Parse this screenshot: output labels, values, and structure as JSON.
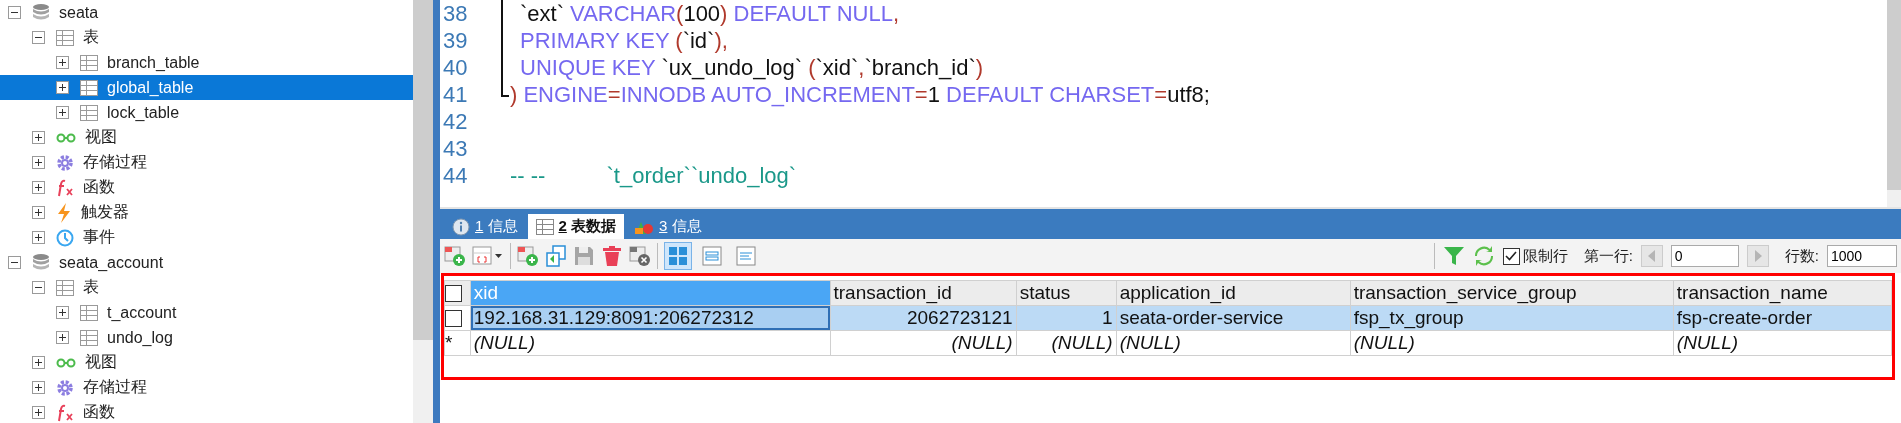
{
  "sidebar": {
    "items": [
      {
        "label": "seata",
        "kind": "database",
        "expanded": true,
        "selected": false,
        "children": [
          {
            "label": "表",
            "kind": "tables",
            "expanded": true,
            "selected": false,
            "children": [
              {
                "label": "branch_table",
                "kind": "table",
                "expanded": false,
                "selected": false
              },
              {
                "label": "global_table",
                "kind": "table",
                "expanded": false,
                "selected": true
              },
              {
                "label": "lock_table",
                "kind": "table",
                "expanded": false,
                "selected": false
              }
            ]
          },
          {
            "label": "视图",
            "kind": "views",
            "expanded": false,
            "selected": false
          },
          {
            "label": "存储过程",
            "kind": "procedures",
            "expanded": false,
            "selected": false
          },
          {
            "label": "函数",
            "kind": "functions",
            "expanded": false,
            "selected": false
          },
          {
            "label": "触发器",
            "kind": "triggers",
            "expanded": false,
            "selected": false
          },
          {
            "label": "事件",
            "kind": "events",
            "expanded": false,
            "selected": false
          }
        ]
      },
      {
        "label": "seata_account",
        "kind": "database",
        "expanded": true,
        "selected": false,
        "children": [
          {
            "label": "表",
            "kind": "tables",
            "expanded": true,
            "selected": false,
            "children": [
              {
                "label": "t_account",
                "kind": "table",
                "expanded": false,
                "selected": false
              },
              {
                "label": "undo_log",
                "kind": "table",
                "expanded": false,
                "selected": false
              }
            ]
          },
          {
            "label": "视图",
            "kind": "views",
            "expanded": false,
            "selected": false
          },
          {
            "label": "存储过程",
            "kind": "procedures",
            "expanded": false,
            "selected": false
          },
          {
            "label": "函数",
            "kind": "functions",
            "expanded": false,
            "selected": false
          }
        ]
      }
    ]
  },
  "editor": {
    "lines": [
      {
        "number": "38",
        "kind": "fold_body",
        "tokens": [
          {
            "text": "`ext`",
            "kind": "ident"
          },
          {
            "text": " VARCHAR",
            "kind": "keyword"
          },
          {
            "text": "(",
            "kind": "punct"
          },
          {
            "text": "100",
            "kind": "number"
          },
          {
            "text": ")",
            "kind": "punct"
          },
          {
            "text": " DEFAULT NULL",
            "kind": "keyword"
          },
          {
            "text": ",",
            "kind": "punct"
          }
        ]
      },
      {
        "number": "39",
        "kind": "fold_body",
        "tokens": [
          {
            "text": "PRIMARY KEY ",
            "kind": "keyword"
          },
          {
            "text": "(",
            "kind": "punct"
          },
          {
            "text": "`id`",
            "kind": "ident"
          },
          {
            "text": "),",
            "kind": "punct"
          }
        ]
      },
      {
        "number": "40",
        "kind": "fold_body",
        "tokens": [
          {
            "text": "UNIQUE KEY ",
            "kind": "keyword"
          },
          {
            "text": "`ux_undo_log`",
            "kind": "ident"
          },
          {
            "text": " (",
            "kind": "punct"
          },
          {
            "text": "`xid`",
            "kind": "ident"
          },
          {
            "text": ",",
            "kind": "punct"
          },
          {
            "text": "`branch_id`",
            "kind": "ident"
          },
          {
            "text": ")",
            "kind": "punct"
          }
        ]
      },
      {
        "number": "41",
        "kind": "fold_end",
        "tokens": [
          {
            "text": ")",
            "kind": "punct"
          },
          {
            "text": " ENGINE",
            "kind": "keyword"
          },
          {
            "text": "=",
            "kind": "punct"
          },
          {
            "text": "INNODB AUTO_INCREMENT",
            "kind": "keyword"
          },
          {
            "text": "=",
            "kind": "punct"
          },
          {
            "text": "1",
            "kind": "number"
          },
          {
            "text": " DEFAULT CHARSET",
            "kind": "keyword"
          },
          {
            "text": "=",
            "kind": "punct"
          },
          {
            "text": "utf8;",
            "kind": "ident"
          }
        ]
      },
      {
        "number": "42",
        "kind": "plain"
      },
      {
        "number": "43",
        "kind": "plain"
      },
      {
        "number": "44",
        "kind": "plain",
        "tokens": [
          {
            "text": "-- --          `t_order``undo_log`",
            "kind": "comment"
          }
        ]
      }
    ]
  },
  "result_tabs": [
    {
      "number": "1",
      "label": "信息",
      "kind": "info",
      "selected": false
    },
    {
      "number": "2",
      "label": "表数据",
      "kind": "data",
      "selected": true
    },
    {
      "number": "3",
      "label": "信息",
      "kind": "profile",
      "selected": false
    }
  ],
  "toolbar": {
    "view_modes": [
      {
        "kind": "grid",
        "selected": true
      },
      {
        "kind": "form",
        "selected": false
      },
      {
        "kind": "text",
        "selected": false
      }
    ],
    "limit_rows": {
      "label": "限制行",
      "checked": true
    },
    "first_row": {
      "label": "第一行:",
      "value": "0"
    },
    "row_count": {
      "label": "行数:",
      "value": "1000"
    }
  },
  "grid": {
    "all_checked": false,
    "columns": [
      {
        "name": "xid",
        "kind": "text",
        "selected": true
      },
      {
        "name": "transaction_id",
        "kind": "numeric",
        "selected": false
      },
      {
        "name": "status",
        "kind": "numeric",
        "selected": false
      },
      {
        "name": "application_id",
        "kind": "text",
        "selected": false
      },
      {
        "name": "transaction_service_group",
        "kind": "text",
        "selected": false
      },
      {
        "name": "transaction_name",
        "kind": "text",
        "selected": false
      }
    ],
    "rows": [
      {
        "kind": "record",
        "checked": false,
        "selected": true,
        "cells": [
          {
            "text": "192.168.31.129:8091:206272312",
            "focused": true
          },
          {
            "text": "2062723121",
            "focused": false
          },
          {
            "text": "1",
            "focused": false
          },
          {
            "text": "seata-order-service",
            "focused": false
          },
          {
            "text": "fsp_tx_group",
            "focused": false
          },
          {
            "text": "fsp-create-order",
            "focused": false
          }
        ]
      },
      {
        "kind": "new",
        "marker": "*",
        "selected": false,
        "cells": [
          {
            "text": "(NULL)",
            "focused": false
          },
          {
            "text": "(NULL)",
            "focused": false
          },
          {
            "text": "(NULL)",
            "focused": false
          },
          {
            "text": "(NULL)",
            "focused": false
          },
          {
            "text": "(NULL)",
            "focused": false
          },
          {
            "text": "(NULL)",
            "focused": false
          }
        ]
      }
    ]
  }
}
